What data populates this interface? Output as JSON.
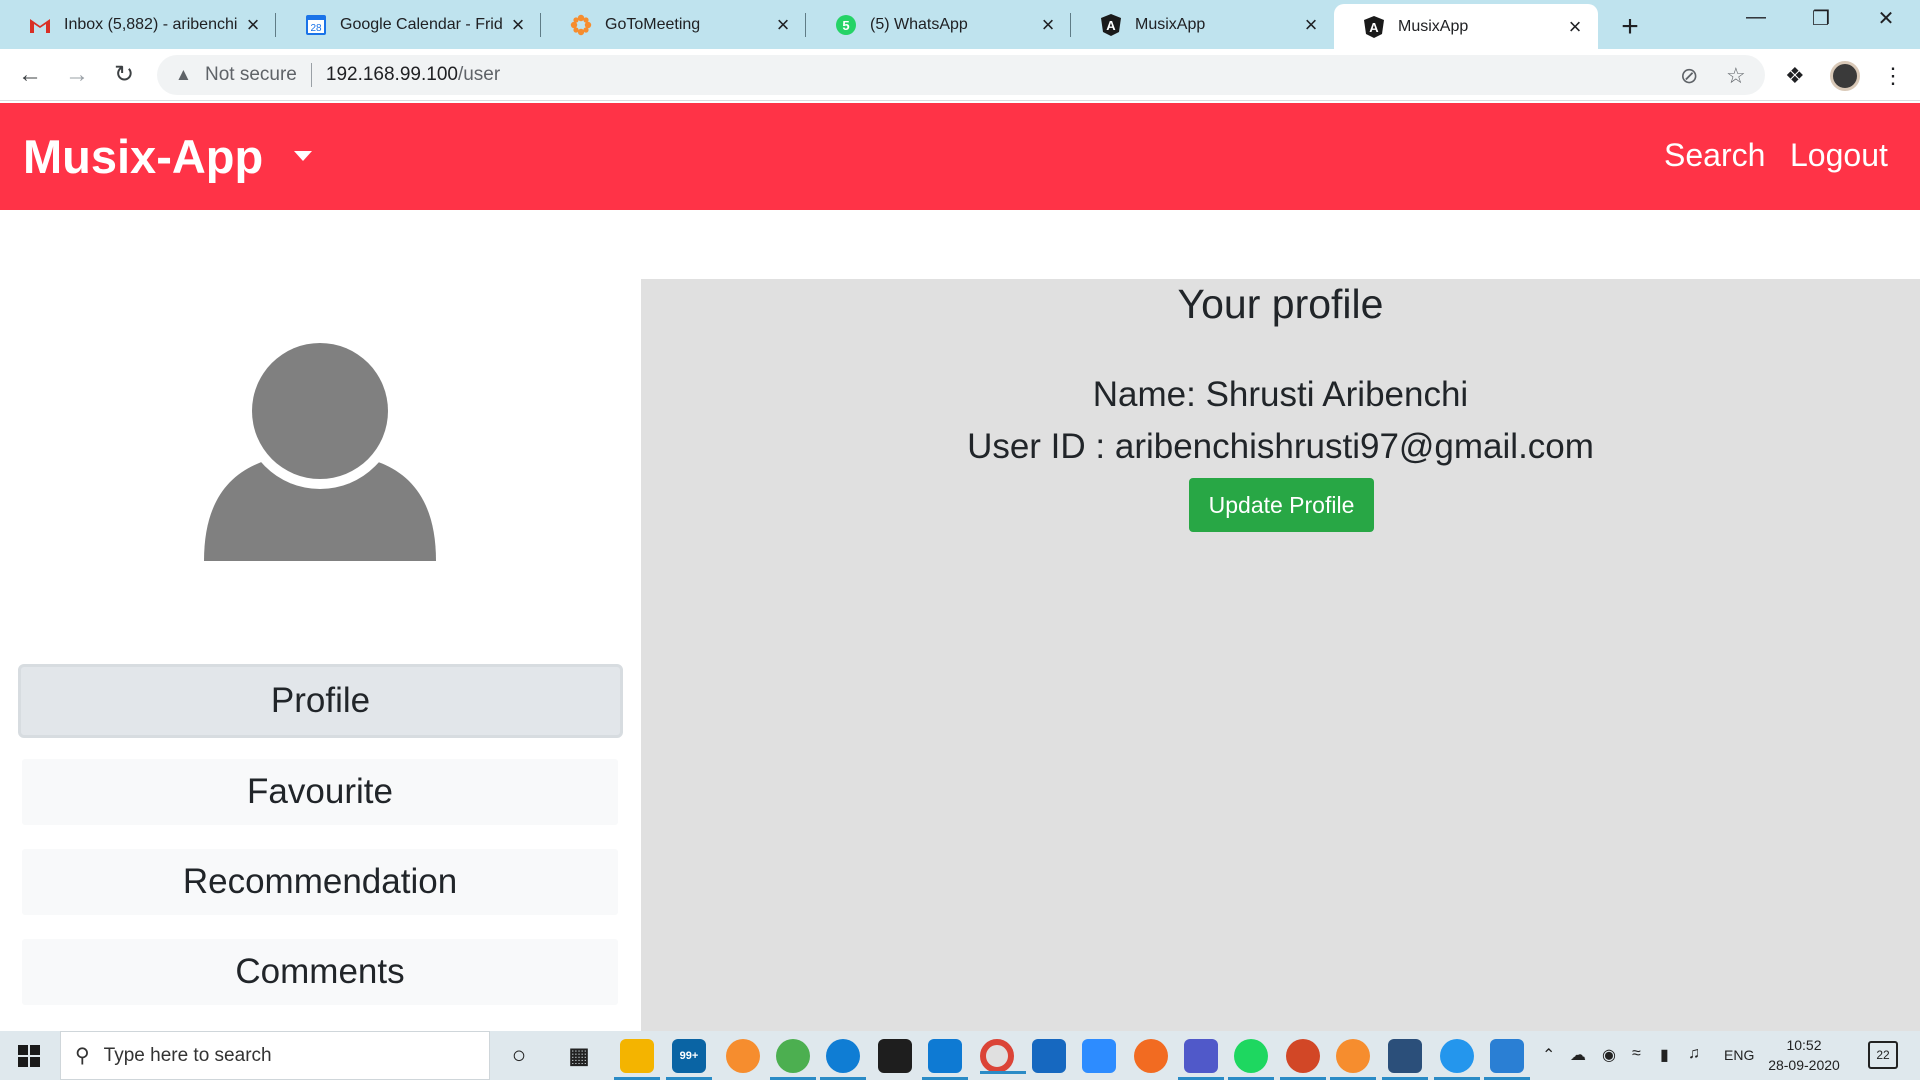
{
  "browser": {
    "tabs": [
      {
        "title": "Inbox (5,882) - aribenchi",
        "icon": "gmail-icon",
        "color": "#d93025"
      },
      {
        "title": "Google Calendar - Frida",
        "icon": "calendar-icon",
        "badge": "28",
        "color": "#1a73e8"
      },
      {
        "title": "GoToMeeting",
        "icon": "gotomeeting-icon",
        "color": "#f68d2e"
      },
      {
        "title": "(5) WhatsApp",
        "icon": "whatsapp-icon",
        "badge": "5",
        "color": "#25d366"
      },
      {
        "title": "MusixApp",
        "icon": "angular-icon",
        "badge": "A"
      },
      {
        "title": "MusixApp",
        "icon": "angular-icon",
        "badge": "A"
      }
    ],
    "close_glyph": "×",
    "new_tab_glyph": "+",
    "address": {
      "security": "Not secure",
      "host": "192.168.99.100",
      "path": "/user"
    }
  },
  "app": {
    "brand": "Musix-App",
    "nav": {
      "search": "Search",
      "logout": "Logout"
    },
    "accent": "#ff3347",
    "sidebar": {
      "items": [
        {
          "label": "Profile",
          "active": true
        },
        {
          "label": "Favourite"
        },
        {
          "label": "Recommendation"
        },
        {
          "label": "Comments"
        }
      ]
    },
    "profile": {
      "heading": "Your profile",
      "name_line": "Name: Shrusti Aribenchi",
      "userid_line": "User ID : aribenchishrusti97@gmail.com",
      "update_button": "Update Profile",
      "button_color": "#28a745"
    }
  },
  "taskbar": {
    "search_placeholder": "Type here to search",
    "mail_badge": "99+",
    "language": "ENG",
    "time": "10:52",
    "date": "28-09-2020",
    "notification_count": "22"
  }
}
